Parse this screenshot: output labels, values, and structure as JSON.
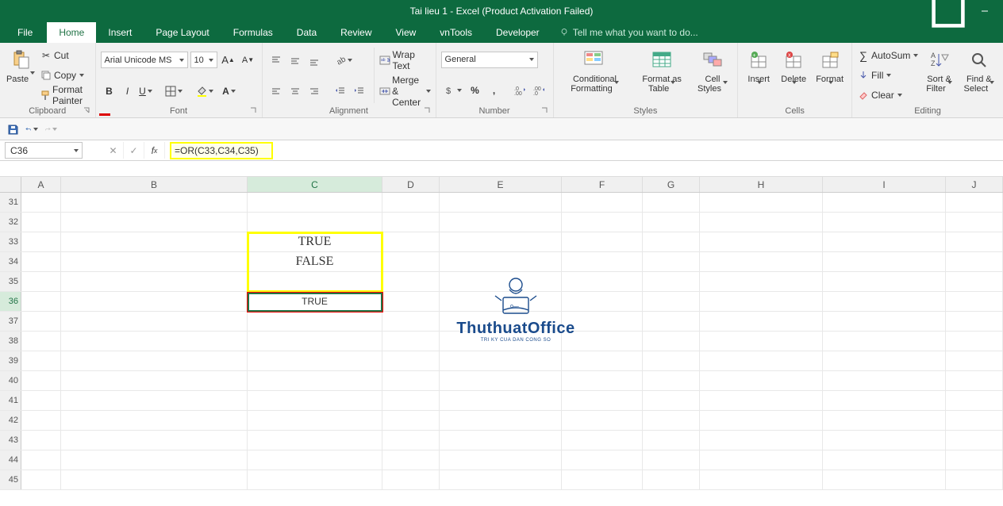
{
  "window": {
    "title": "Tai lieu 1 - Excel (Product Activation Failed)"
  },
  "tabs": {
    "file": "File",
    "home": "Home",
    "insert": "Insert",
    "pageLayout": "Page Layout",
    "formulas": "Formulas",
    "data": "Data",
    "review": "Review",
    "view": "View",
    "vntools": "vnTools",
    "developer": "Developer",
    "tellMe": "Tell me what you want to do..."
  },
  "ribbon": {
    "clipboard": {
      "label": "Clipboard",
      "paste": "Paste",
      "cut": "Cut",
      "copy": "Copy",
      "painter": "Format Painter"
    },
    "font": {
      "label": "Font",
      "name": "Arial Unicode MS",
      "size": "10"
    },
    "alignment": {
      "label": "Alignment",
      "wrap": "Wrap Text",
      "merge": "Merge & Center"
    },
    "number": {
      "label": "Number",
      "format": "General"
    },
    "styles": {
      "label": "Styles",
      "cond": "Conditional Formatting",
      "table": "Format as Table",
      "cell": "Cell Styles"
    },
    "cells": {
      "label": "Cells",
      "insert": "Insert",
      "delete": "Delete",
      "format": "Format"
    },
    "editing": {
      "label": "Editing",
      "autosum": "AutoSum",
      "fill": "Fill",
      "clear": "Clear",
      "sort": "Sort & Filter",
      "find": "Find & Select"
    }
  },
  "nameBox": "C36",
  "formula": "=OR(C33,C34,C35)",
  "columns": [
    "A",
    "B",
    "C",
    "D",
    "E",
    "F",
    "G",
    "H",
    "I",
    "J"
  ],
  "rowStart": 31,
  "rowEnd": 45,
  "activeCell": {
    "row": 36,
    "col": "C"
  },
  "cells": {
    "C33": "TRUE",
    "C34": "FALSE",
    "C36": "TRUE"
  },
  "watermark": {
    "brand": "ThuthuatOffice",
    "tagline": "TRI KY CUA DAN CONG SO"
  }
}
